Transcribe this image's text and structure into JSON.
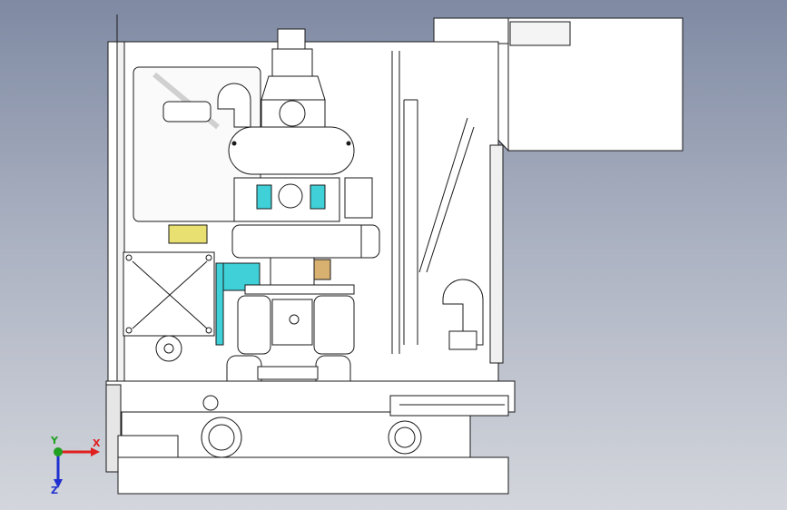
{
  "viewport": {
    "background_top": "#7f8aa3",
    "background_bottom": "#d3d6dc",
    "line_color": "#1a1a1a",
    "part_fill": "#ffffff",
    "accent_cyan": "#3fd0d8",
    "accent_yellow": "#e8e070",
    "accent_tan": "#d8b070"
  },
  "triad": {
    "x_label": "X",
    "y_label": "Y",
    "z_label": "Z",
    "x_color": "#e02020",
    "y_color": "#20a020",
    "z_color": "#2030d0"
  }
}
